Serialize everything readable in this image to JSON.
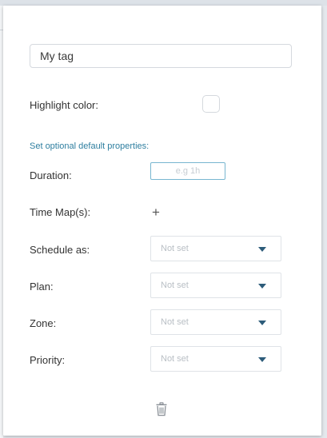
{
  "tag": {
    "name_value": "My tag",
    "name_placeholder": ""
  },
  "highlight": {
    "label": "Highlight color:"
  },
  "defaults": {
    "section_label": "Set optional default properties:",
    "duration": {
      "label": "Duration:",
      "placeholder": "e.g 1h"
    },
    "time_maps": {
      "label": "Time Map(s):",
      "add_symbol": "+"
    },
    "fields": [
      {
        "label": "Schedule as:",
        "value": "Not set"
      },
      {
        "label": "Plan:",
        "value": "Not set"
      },
      {
        "label": "Zone:",
        "value": "Not set"
      },
      {
        "label": "Priority:",
        "value": "Not set"
      }
    ]
  },
  "colors": {
    "accent_text": "#2f7fa0",
    "input_focus_border": "#78b6d0",
    "caret": "#2d5c7a",
    "placeholder": "#b9bfc5"
  },
  "icons": {
    "add": "plus-icon",
    "dropdown": "caret-down-icon",
    "delete": "trash-icon"
  }
}
